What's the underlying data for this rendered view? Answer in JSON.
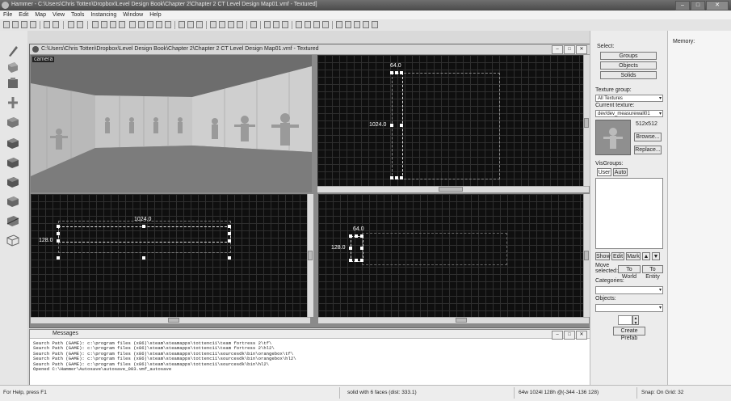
{
  "window": {
    "title": "Hammer - C:\\Users\\Chris Totten\\Dropbox\\Level Design Book\\Chapter 2\\Chapter 2 CT Level Design Map01.vmf - Textured]",
    "min": "–",
    "max": "□",
    "close": "✕"
  },
  "menu": [
    "File",
    "Edit",
    "Map",
    "View",
    "Tools",
    "Instancing",
    "Window",
    "Help"
  ],
  "document": {
    "title": "C:\\Users\\Chris Totten\\Dropbox\\Level Design Book\\Chapter 2\\Chapter 2 CT Level Design Map01.vmf - Textured"
  },
  "viewports": {
    "camera_label": "camera",
    "top": {
      "width_label": "64.0",
      "height_label": "1024.0"
    },
    "front": {
      "width_label": "1024.0",
      "height_label": "128.0"
    },
    "side": {
      "width_label": "64.0",
      "height_label": "128.0"
    }
  },
  "messages": {
    "title": "Messages",
    "lines": [
      "Search Path (GAME): c:\\program files (x86)\\steam\\steamapps\\tottenc11\\team fortress 2\\tf\\",
      "Search Path (GAME): c:\\program files (x86)\\steam\\steamapps\\tottenc11\\team fortress 2\\hl2\\",
      "Search Path (GAME): c:\\program files (x86)\\steam\\steamapps\\tottenc11\\sourcesdk\\bin\\orangebox\\tf\\",
      "Search Path (GAME): c:\\program files (x86)\\steam\\steamapps\\tottenc11\\sourcesdk\\bin\\orangebox\\hl2\\",
      "Search Path (GAME): c:\\program files (x86)\\steam\\steamapps\\tottenc11\\sourcesdk\\bin\\hl2\\",
      "Opened C:\\Hammer\\Autosave\\autosave_003.vmf_autosave"
    ]
  },
  "right_panel": {
    "select_label": "Select:",
    "groups": "Groups",
    "objects": "Objects",
    "solids": "Solids",
    "texture_group_label": "Texture group:",
    "texture_group_value": "All Textures",
    "current_texture_label": "Current texture:",
    "current_texture_value": "dev/dev_measurewall01",
    "texture_size": "512x512",
    "browse": "Browse...",
    "replace": "Replace...",
    "visgroups_label": "VisGroups:",
    "tab_user": "User",
    "tab_auto": "Auto",
    "show": "Show",
    "edit": "Edit",
    "mark": "Mark",
    "move_selected": "Move selected:",
    "to_world": "To World",
    "to_entity": "To Entity",
    "categories_label": "Categories:",
    "objects_label": "Objects:",
    "create_prefab": "Create Prefab"
  },
  "far_right": {
    "header": "Memory:"
  },
  "status": {
    "help": "For Help, press F1",
    "selection": "solid with 6 faces  (dist: 333.1)",
    "size": "64w 1024l 128h @(-344 -136 128)",
    "snap": "Snap: On Grid: 32"
  }
}
